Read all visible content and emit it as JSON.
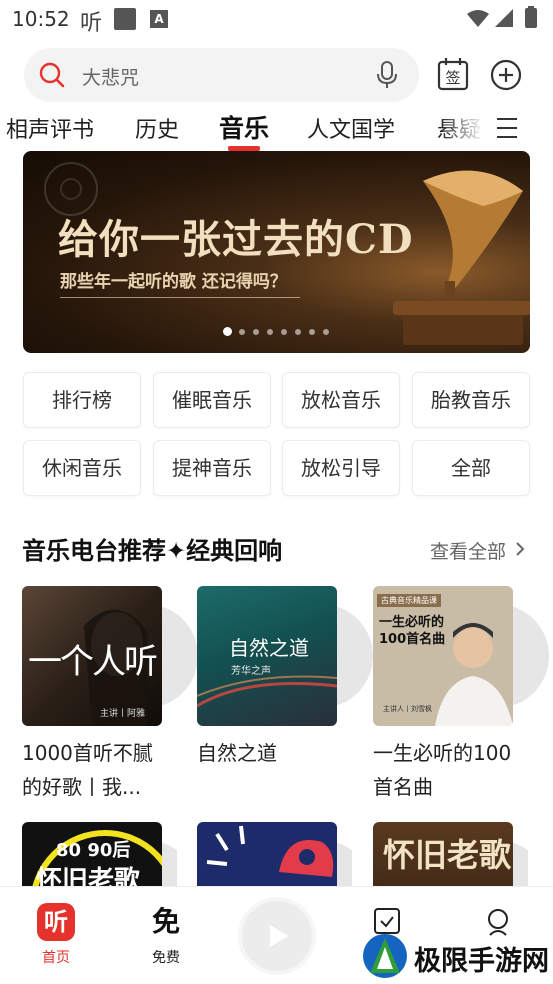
{
  "status_bar": {
    "time": "10:52",
    "app_glyph": "听",
    "notification_letter": "A"
  },
  "search": {
    "placeholder": "大悲咒",
    "sign_label": "签"
  },
  "tabs": [
    {
      "label": "相声评书",
      "active": false
    },
    {
      "label": "历史",
      "active": false
    },
    {
      "label": "音乐",
      "active": true
    },
    {
      "label": "人文国学",
      "active": false
    },
    {
      "label": "悬疑",
      "active": false
    }
  ],
  "banner": {
    "title": "给你一张过去的CD",
    "subtitle": "那些年一起听的歌 还记得吗？",
    "page_count": 8,
    "current_page": 1
  },
  "chips": [
    {
      "label": "排行榜"
    },
    {
      "label": "催眠音乐"
    },
    {
      "label": "放松音乐"
    },
    {
      "label": "胎教音乐"
    },
    {
      "label": "休闲音乐"
    },
    {
      "label": "提神音乐"
    },
    {
      "label": "放松引导"
    },
    {
      "label": "全部"
    }
  ],
  "section": {
    "title": "音乐电台推荐✦经典回响",
    "more_label": "查看全部"
  },
  "albums": [
    {
      "title": "1000首听不腻的好歌丨我...",
      "cover_text": "一个人听",
      "cover_sub": "主讲丨阿雅"
    },
    {
      "title": "自然之道",
      "cover_text": "自然之道",
      "cover_sub": "芳华之声"
    },
    {
      "title": "一生必听的100首名曲",
      "cover_text": "一生必听的100首名曲",
      "cover_sub": "古典音乐精品课",
      "cover_host": "主讲人丨刘雪枫"
    }
  ],
  "albums_row2": [
    {
      "cover_text": "80 90后",
      "cover_text2": "怀旧老歌"
    },
    {
      "cover_text": ""
    },
    {
      "cover_text": "怀旧老歌"
    }
  ],
  "bottom_nav": [
    {
      "label": "首页",
      "icon_glyph": "听",
      "active": true
    },
    {
      "label": "免费",
      "icon_glyph": "免",
      "active": false
    }
  ],
  "watermark": {
    "text": "极限手游网"
  },
  "colors": {
    "accent": "#e5322d",
    "banner_text": "#f2dfbf"
  }
}
